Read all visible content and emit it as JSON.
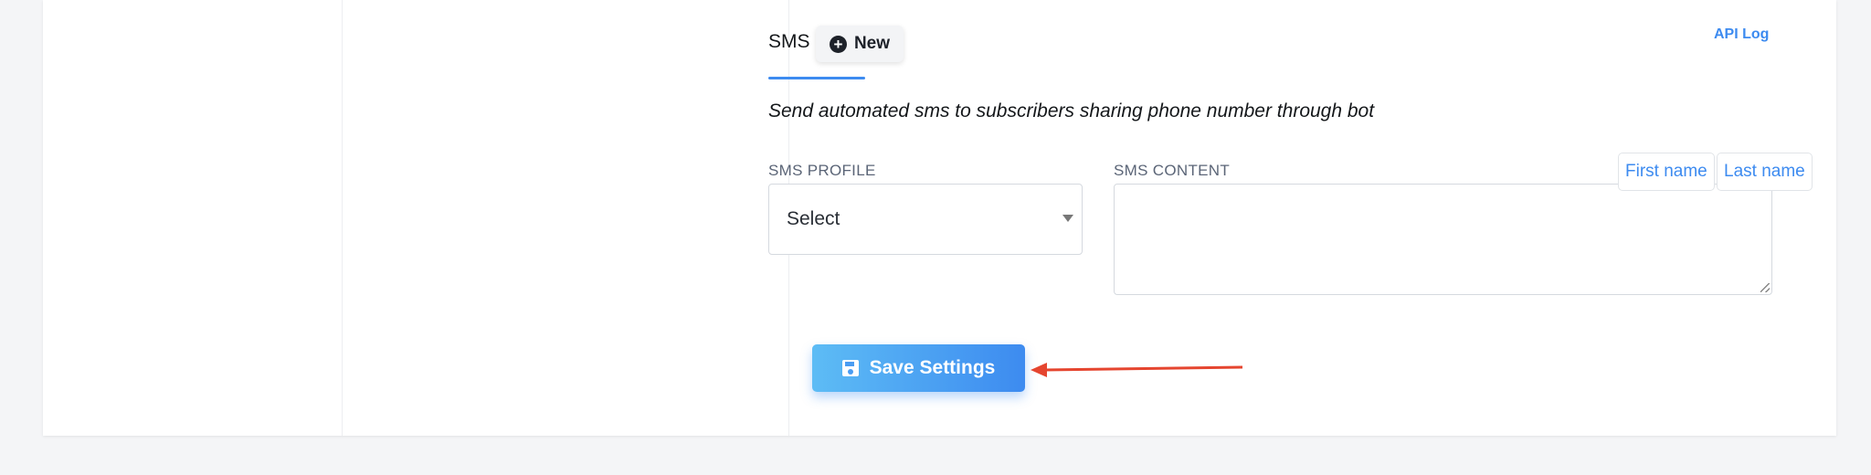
{
  "tab": {
    "label": "SMS"
  },
  "new_button": {
    "label": "New",
    "icon": "plus-circle-icon"
  },
  "api_log": {
    "label": "API Log"
  },
  "description": "Send automated sms to subscribers sharing phone number through bot",
  "sms_profile": {
    "label": "SMS PROFILE",
    "selected": "Select"
  },
  "sms_content": {
    "label": "SMS CONTENT",
    "value": "",
    "variables": [
      "First name",
      "Last name"
    ]
  },
  "save_button": {
    "label": "Save Settings",
    "icon": "floppy-disk-icon"
  },
  "colors": {
    "accent": "#3d8bf0",
    "gradient_start": "#5dbcf5",
    "arrow": "#e5452f"
  }
}
